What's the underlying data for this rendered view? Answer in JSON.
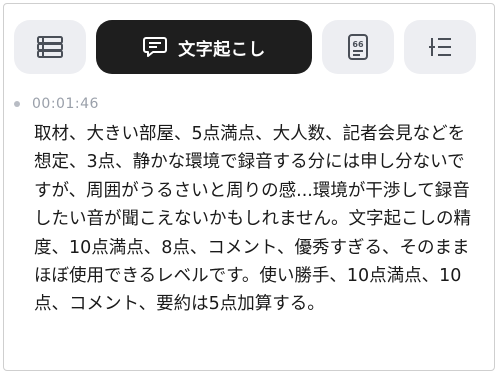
{
  "toolbar": {
    "buttons": [
      {
        "icon": "list-icon"
      },
      {
        "icon": "speech-bubble-icon",
        "label": "文字起こし",
        "active": true
      },
      {
        "icon": "summary-icon"
      },
      {
        "icon": "outline-icon"
      }
    ],
    "active_color": "#1e1e1e",
    "inactive_color": "#edeef2"
  },
  "entry": {
    "timestamp": "00:01:46",
    "text": "取材、大きい部屋、5点満点、大人数、記者会見などを想定、3点、静かな環境で録音する分には申し分ないですが、周囲がうるさいと周りの感...環境が干渉して録音したい音が聞こえないかもしれません。文字起こしの精度、10点満点、8点、コメント、優秀すぎる、そのままほぼ使用できるレベルです。使い勝手、10点満点、10点、コメント、要約は5点加算する。"
  }
}
